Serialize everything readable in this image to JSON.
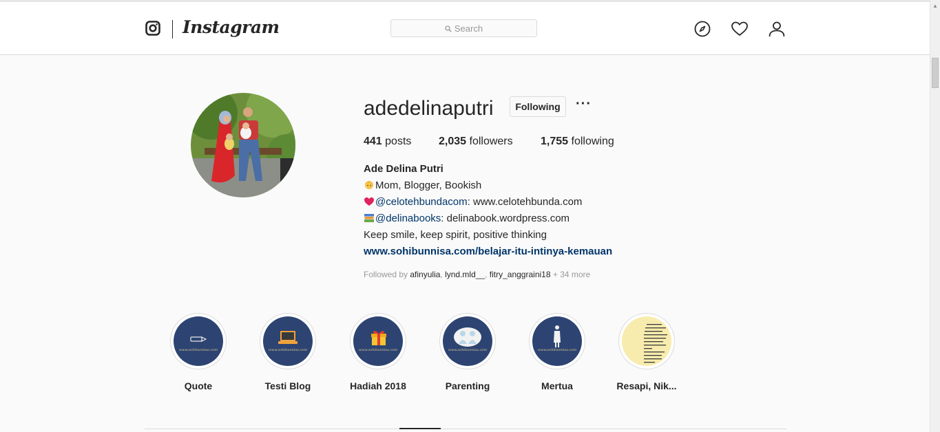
{
  "header": {
    "wordmark": "Instagram",
    "search_placeholder": "Search",
    "icons": [
      "instagram-glyph-icon",
      "compass-icon",
      "heart-icon",
      "person-icon",
      "search-icon"
    ]
  },
  "profile": {
    "username": "adedelinaputri",
    "follow_button": "Following",
    "more_label": "···",
    "stats": {
      "posts_count": "441",
      "posts_label": "posts",
      "followers_count": "2,035",
      "followers_label": "followers",
      "following_count": "1,755",
      "following_label": "following"
    },
    "bio": {
      "name": "Ade Delina Putri",
      "line1": "Mom, Blogger, Bookish",
      "line2_mention": "@celotehbundacom",
      "line2_rest": ": www.celotehbunda.com",
      "line3_mention": "@delinabooks",
      "line3_rest": ": delinabook.wordpress.com",
      "line4": "Keep smile, keep spirit, positive thinking",
      "link": "www.sohibunnisa.com/belajar-itu-intinya-kemauan"
    },
    "followed_by": {
      "prefix": "Followed by ",
      "names": [
        "afinyulia",
        "lynd.mld__",
        "fitry_anggraini18"
      ],
      "more": "+ 34 more"
    }
  },
  "highlights": [
    {
      "label": "Quote",
      "site": "www.sohibunnisa.com"
    },
    {
      "label": "Testi Blog",
      "site": "www.sohibunnisa.com"
    },
    {
      "label": "Hadiah 2018",
      "site": "www.sohibunnisa.com"
    },
    {
      "label": "Parenting",
      "site": "www.sohibunnisa.com"
    },
    {
      "label": "Mertua",
      "site": "www.sohibunnisa.com"
    },
    {
      "label": "Resapi, Nik..."
    }
  ],
  "colors": {
    "link": "#003569",
    "highlight_cover": "#2d4472",
    "text": "#262626",
    "muted": "#999999"
  }
}
